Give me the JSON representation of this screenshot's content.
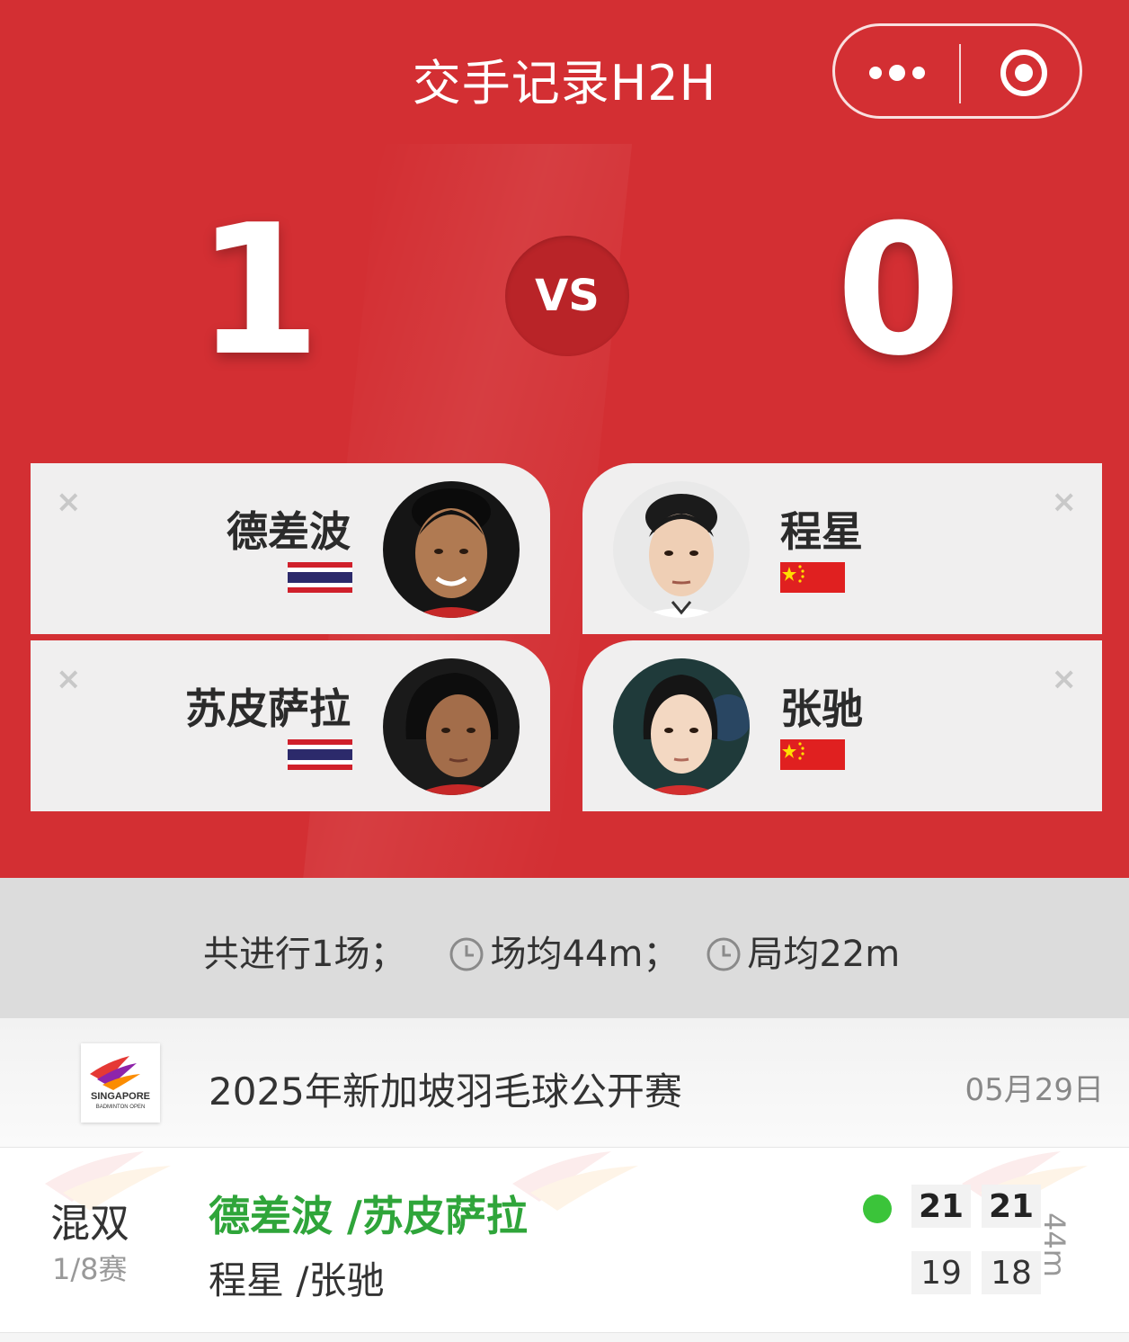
{
  "header": {
    "title": "交手记录H2H",
    "menu_icon": "more-dots-icon",
    "close_icon": "target-circle-icon"
  },
  "scoreboard": {
    "left_wins": "1",
    "vs_label": "VS",
    "right_wins": "0"
  },
  "teams": {
    "left": [
      {
        "name": "德差波",
        "country_flag": "thailand-flag",
        "remove_icon": "×"
      },
      {
        "name": "苏皮萨拉",
        "country_flag": "thailand-flag",
        "remove_icon": "×"
      }
    ],
    "right": [
      {
        "name": "程星",
        "country_flag": "china-flag",
        "remove_icon": "×"
      },
      {
        "name": "张驰",
        "country_flag": "china-flag",
        "remove_icon": "×"
      }
    ]
  },
  "summary": {
    "total": "共进行1场；",
    "match_avg": "场均44m；",
    "game_avg": "局均22m"
  },
  "tournament": {
    "name": "2025年新加坡羽毛球公开赛",
    "date": "05月29日",
    "logo_text_1": "SINGAPORE",
    "logo_text_2": "BADMINTON OPEN"
  },
  "match": {
    "event": "混双",
    "round": "1/8赛",
    "winner_pair": "德差波 /苏皮萨拉",
    "loser_pair": "程星 /张驰",
    "winner_scores": [
      "21",
      "21"
    ],
    "loser_scores": [
      "19",
      "18"
    ],
    "duration": "44m"
  },
  "colors": {
    "hero_red": "#d32f33",
    "vs_red": "#b92428",
    "winner_green": "#2fa53a",
    "win_dot": "#3bc43a"
  }
}
